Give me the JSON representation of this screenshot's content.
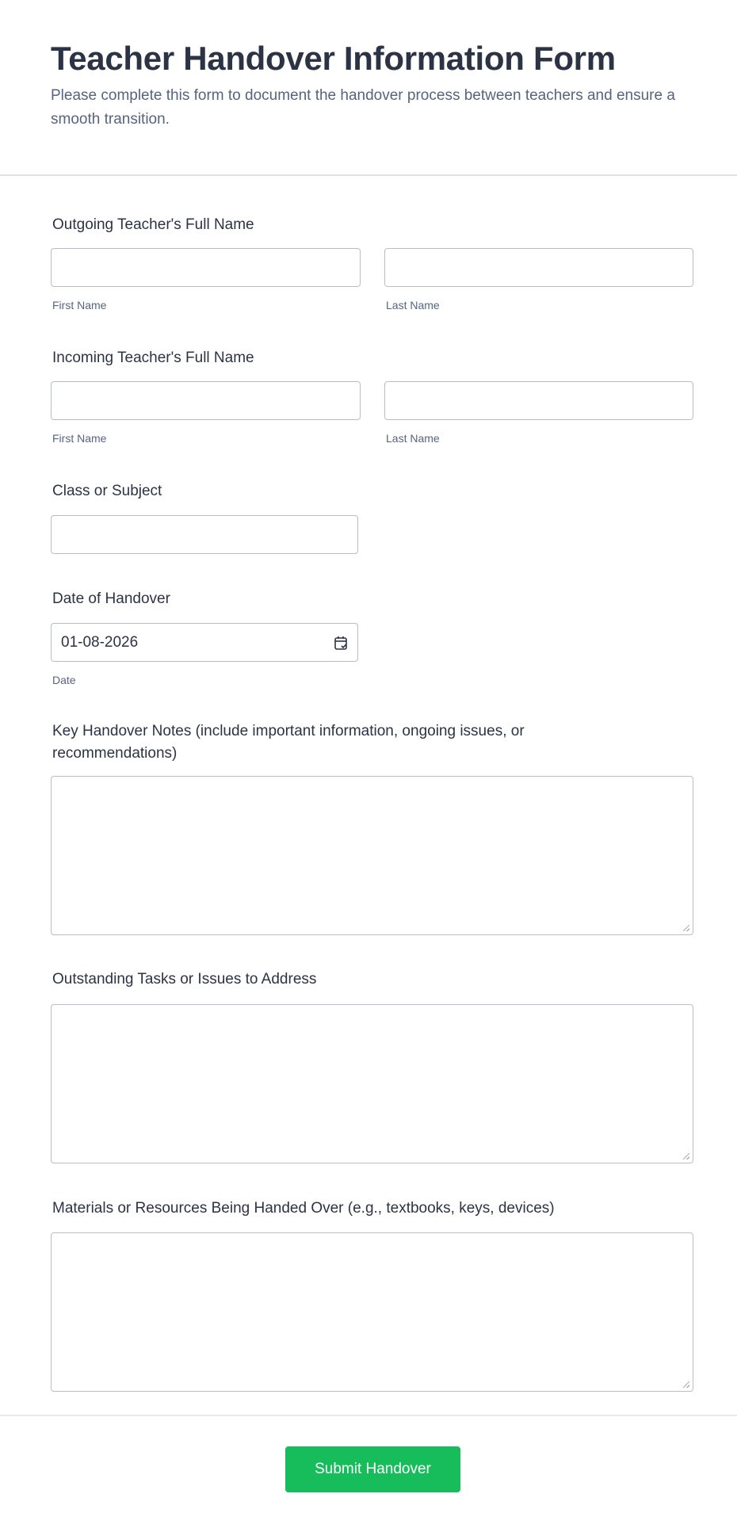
{
  "header": {
    "title": "Teacher Handover Information Form",
    "description": "Please complete this form to document the handover process between teachers and ensure a smooth transition."
  },
  "fields": {
    "outgoing": {
      "label": "Outgoing Teacher's Full Name",
      "first_sublabel": "First Name",
      "last_sublabel": "Last Name",
      "first_value": "",
      "last_value": ""
    },
    "incoming": {
      "label": "Incoming Teacher's Full Name",
      "first_sublabel": "First Name",
      "last_sublabel": "Last Name",
      "first_value": "",
      "last_value": ""
    },
    "class_subject": {
      "label": "Class or Subject",
      "value": ""
    },
    "date": {
      "label": "Date of Handover",
      "value": "01-08-2026",
      "sublabel": "Date",
      "icon": "calendar-check-icon"
    },
    "notes": {
      "label": "Key Handover Notes (include important information, ongoing issues, or recommendations)",
      "value": ""
    },
    "tasks": {
      "label": "Outstanding Tasks or Issues to Address",
      "value": ""
    },
    "materials": {
      "label": "Materials or Resources Being Handed Over (e.g., textbooks, keys, devices)",
      "value": ""
    }
  },
  "submit": {
    "label": "Submit Handover",
    "color": "#18bd5b"
  }
}
